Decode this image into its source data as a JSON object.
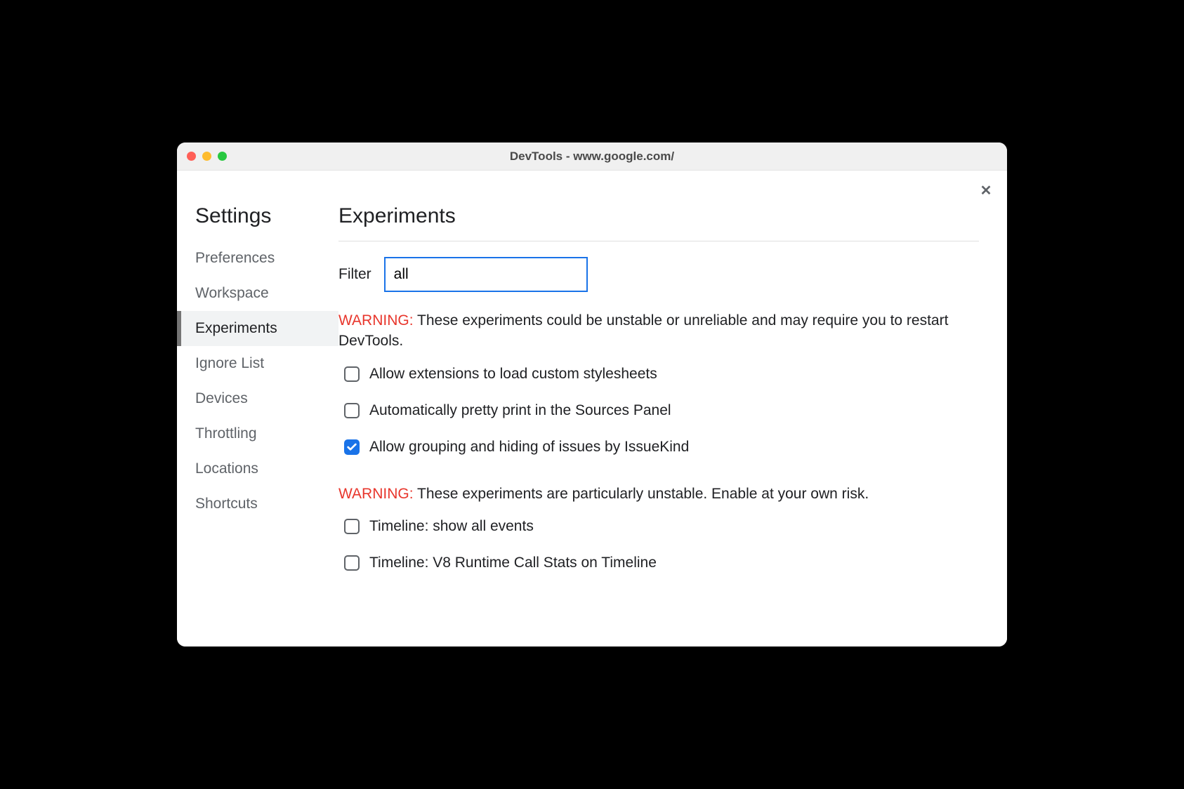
{
  "window": {
    "title": "DevTools - www.google.com/"
  },
  "sidebar": {
    "title": "Settings",
    "items": [
      {
        "label": "Preferences",
        "active": false
      },
      {
        "label": "Workspace",
        "active": false
      },
      {
        "label": "Experiments",
        "active": true
      },
      {
        "label": "Ignore List",
        "active": false
      },
      {
        "label": "Devices",
        "active": false
      },
      {
        "label": "Throttling",
        "active": false
      },
      {
        "label": "Locations",
        "active": false
      },
      {
        "label": "Shortcuts",
        "active": false
      }
    ]
  },
  "main": {
    "title": "Experiments",
    "filter": {
      "label": "Filter",
      "value": "all"
    },
    "warning1": {
      "prefix": "WARNING:",
      "text": " These experiments could be unstable or unreliable and may require you to restart DevTools."
    },
    "experiments_group1": [
      {
        "label": "Allow extensions to load custom stylesheets",
        "checked": false
      },
      {
        "label": "Automatically pretty print in the Sources Panel",
        "checked": false
      },
      {
        "label": "Allow grouping and hiding of issues by IssueKind",
        "checked": true
      }
    ],
    "warning2": {
      "prefix": "WARNING:",
      "text": " These experiments are particularly unstable. Enable at your own risk."
    },
    "experiments_group2": [
      {
        "label": "Timeline: show all events",
        "checked": false
      },
      {
        "label": "Timeline: V8 Runtime Call Stats on Timeline",
        "checked": false
      }
    ]
  }
}
